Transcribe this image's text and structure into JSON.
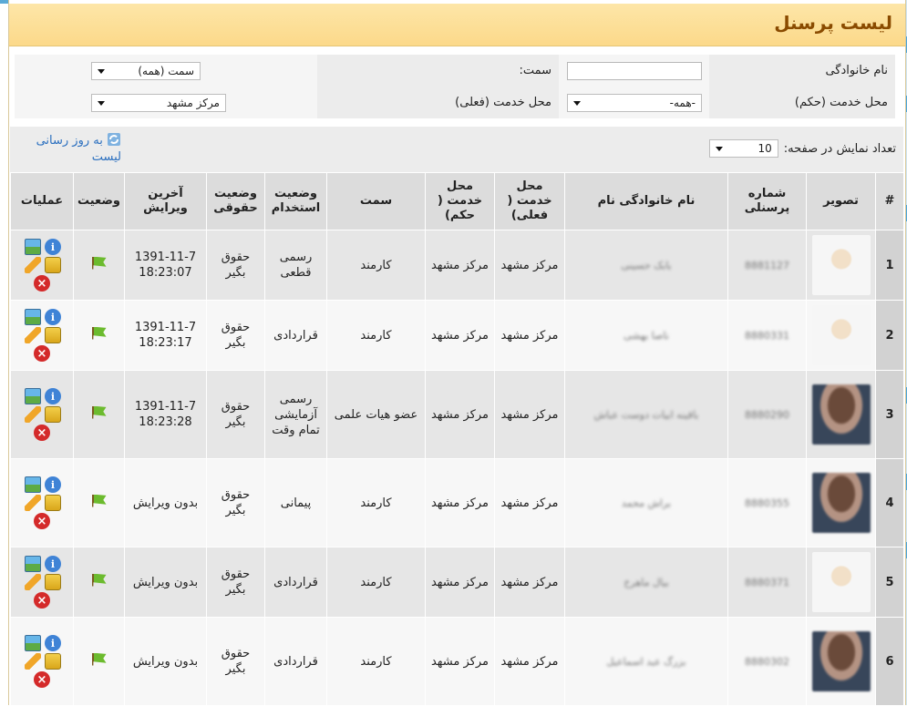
{
  "header": {
    "title": "لیست پرسنل"
  },
  "filters": {
    "family_label": "نام خانوادگی",
    "family_value": "",
    "position_label": "سمت:",
    "position_select": "سمت (همه)",
    "service_hokm_label": "محل خدمت (حکم)",
    "service_hokm_select": "-همه-",
    "service_current_label": "محل خدمت (فعلی)",
    "service_current_select": "مرکز مشهد"
  },
  "toolbar": {
    "page_size_label": "تعداد نمایش در صفحه:",
    "page_size_value": "10",
    "refresh_label": "به روز رسانی لیست"
  },
  "table": {
    "columns": [
      "#",
      "تصویر",
      "شماره پرسنلی",
      "نام خانوادگی نام",
      "محل خدمت ( فعلی)",
      "محل خدمت ( حکم)",
      "سمت",
      "وضعیت استخدام",
      "وضعیت حقوقی",
      "آخرین ویرایش",
      "وضعیت",
      "عملیات"
    ],
    "rows": [
      {
        "num": "1",
        "photo": "light",
        "code": "8881127",
        "name": "بابک حسینی",
        "current": "مرکز مشهد",
        "hokm": "مرکز مشهد",
        "position": "کارمند",
        "employment": "رسمی قطعی",
        "salary": "حقوق بگیر",
        "edited": "1391-11-7 18:23:07"
      },
      {
        "num": "2",
        "photo": "light",
        "code": "8880331",
        "name": "ناصا بهشی",
        "current": "مرکز مشهد",
        "hokm": "مرکز مشهد",
        "position": "کارمند",
        "employment": "قراردادی",
        "salary": "حقوق بگیر",
        "edited": "1391-11-7 18:23:17"
      },
      {
        "num": "3",
        "photo": "dark",
        "code": "8880290",
        "name": "باقینه ابیات دوست عباش",
        "current": "مرکز مشهد",
        "hokm": "مرکز مشهد",
        "position": "عضو هیات علمی",
        "employment": "رسمی آزمایشی تمام وقت",
        "salary": "حقوق بگیر",
        "edited": "1391-11-7 18:23:28"
      },
      {
        "num": "4",
        "photo": "dark",
        "code": "8880355",
        "name": "براش محمد",
        "current": "مرکز مشهد",
        "hokm": "مرکز مشهد",
        "position": "کارمند",
        "employment": "پیمانی",
        "salary": "حقوق بگیر",
        "edited": "بدون ویرایش"
      },
      {
        "num": "5",
        "photo": "light",
        "code": "8880371",
        "name": "بیال ماهرخ",
        "current": "مرکز مشهد",
        "hokm": "مرکز مشهد",
        "position": "کارمند",
        "employment": "قراردادی",
        "salary": "حقوق بگیر",
        "edited": "بدون ویرایش"
      },
      {
        "num": "6",
        "photo": "dark",
        "code": "8880302",
        "name": "بزرگ عبد اسماعیل",
        "current": "مرکز مشهد",
        "hokm": "مرکز مشهد",
        "position": "کارمند",
        "employment": "قراردادی",
        "salary": "حقوق بگیر",
        "edited": "بدون ویرایش"
      }
    ]
  },
  "icons": {
    "refresh": "refresh-icon",
    "image": "image-icon",
    "info": "info-icon",
    "edit": "pencil-icon",
    "permissions": "lock-icon",
    "delete": "delete-icon",
    "status": "flag-icon"
  }
}
